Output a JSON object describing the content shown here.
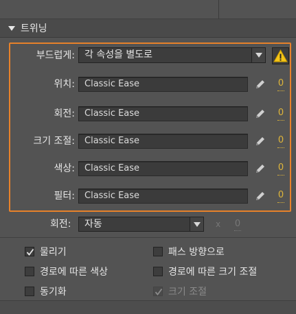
{
  "section": {
    "title": "트위닝"
  },
  "easing_mode": {
    "label": "부드럽게:",
    "value": "각 속성을 별도로"
  },
  "properties": [
    {
      "label": "위치:",
      "ease": "Classic Ease",
      "value": "0"
    },
    {
      "label": "회전:",
      "ease": "Classic Ease",
      "value": "0"
    },
    {
      "label": "크기 조절:",
      "ease": "Classic Ease",
      "value": "0"
    },
    {
      "label": "색상:",
      "ease": "Classic Ease",
      "value": "0"
    },
    {
      "label": "필터:",
      "ease": "Classic Ease",
      "value": "0"
    }
  ],
  "rotation": {
    "label": "회전:",
    "value": "자동",
    "times_symbol": "x",
    "count": "0"
  },
  "options": [
    {
      "label": "물리기",
      "checked": true,
      "enabled": true
    },
    {
      "label": "패스 방향으로",
      "checked": false,
      "enabled": true
    },
    {
      "label": "경로에 따른 색상",
      "checked": false,
      "enabled": true
    },
    {
      "label": "경로에 따른 크기 조절",
      "checked": false,
      "enabled": true
    },
    {
      "label": "동기화",
      "checked": false,
      "enabled": true
    },
    {
      "label": "크기 조절",
      "checked": true,
      "enabled": false
    }
  ],
  "colors": {
    "highlight": "#e8822a",
    "value_link": "#e0b63a",
    "warning": "#f5c518"
  },
  "icons": {
    "pencil": "pencil-icon",
    "warning": "warning-icon",
    "dropdown": "chevron-down-icon"
  }
}
